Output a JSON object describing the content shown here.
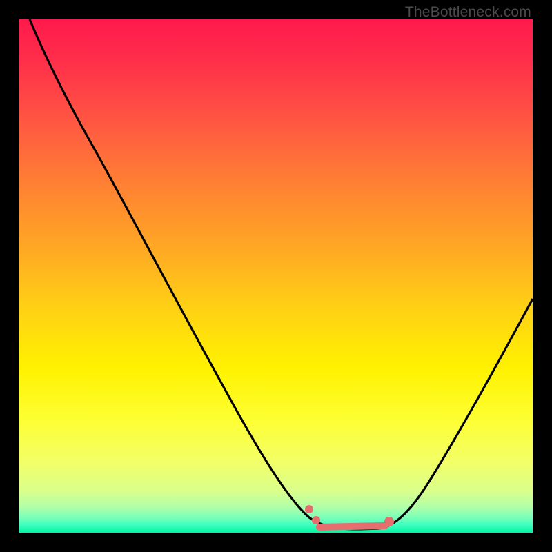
{
  "watermark": "TheBottleneck.com",
  "chart_data": {
    "type": "line",
    "title": "",
    "xlabel": "",
    "ylabel": "",
    "xlim": [
      0,
      100
    ],
    "ylim": [
      0,
      100
    ],
    "series": [
      {
        "name": "curve",
        "x": [
          2,
          10,
          20,
          30,
          40,
          50,
          57,
          60,
          63,
          67,
          70,
          76,
          82,
          88,
          94,
          100
        ],
        "values": [
          100,
          88,
          72,
          56,
          40,
          24,
          10,
          6,
          3,
          2,
          2,
          4,
          12,
          24,
          36,
          48
        ]
      }
    ],
    "markers": {
      "flat_segment": {
        "x_start": 58,
        "x_end": 71,
        "y": 2
      },
      "dots": [
        {
          "x": 56.5,
          "y": 6
        },
        {
          "x": 58,
          "y": 3.5
        }
      ],
      "color": "#e66e6e"
    },
    "background_gradient": {
      "top": "#ff1a4d",
      "mid": "#fff200",
      "bottom": "#00f5a0"
    }
  }
}
